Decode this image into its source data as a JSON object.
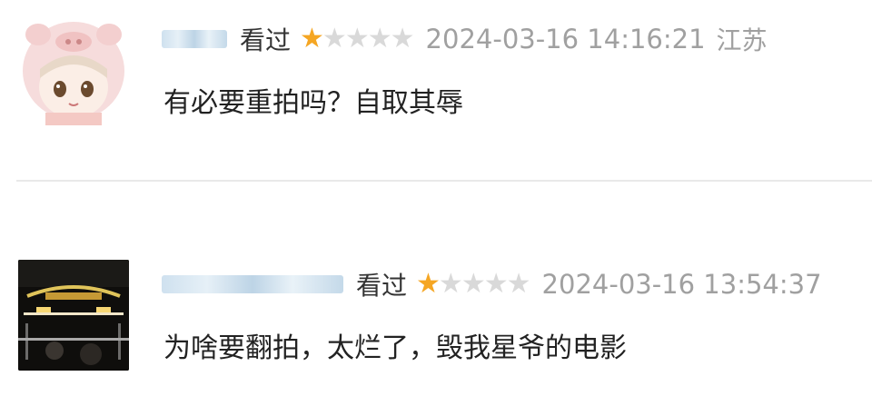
{
  "comments": [
    {
      "status": "看过",
      "rating": 1,
      "max_rating": 5,
      "time": "2024-03-16 14:16:21",
      "location": "江苏",
      "content": "有必要重拍吗？自取其辱",
      "avatar_icon": "pig-hood-girl-icon"
    },
    {
      "status": "看过",
      "rating": 1,
      "max_rating": 5,
      "time": "2024-03-16 13:54:37",
      "content": "为啥要翻拍，太烂了，毁我星爷的电影",
      "avatar_icon": "night-lights-photo-icon"
    }
  ],
  "colors": {
    "star_on": "#f5a623",
    "star_off": "#d9d9d9",
    "meta_text": "#a0a0a0",
    "body_text": "#222222"
  }
}
